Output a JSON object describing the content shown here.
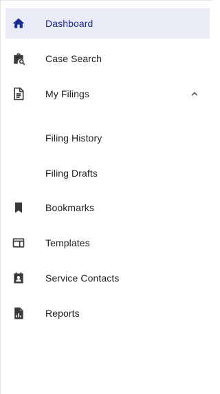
{
  "sidebar": {
    "items": [
      {
        "label": "Dashboard",
        "icon": "home-icon",
        "active": true
      },
      {
        "label": "Case Search",
        "icon": "briefcase-search-icon"
      },
      {
        "label": "My Filings",
        "icon": "document-icon",
        "expanded": true
      },
      {
        "label": "Filing History",
        "sub": true
      },
      {
        "label": "Filing Drafts",
        "sub": true
      },
      {
        "label": "Bookmarks",
        "icon": "bookmark-icon"
      },
      {
        "label": "Templates",
        "icon": "template-icon"
      },
      {
        "label": "Service Contacts",
        "icon": "contact-calendar-icon"
      },
      {
        "label": "Reports",
        "icon": "report-icon"
      }
    ]
  },
  "colors": {
    "accent": "#1a2b8f",
    "active_bg": "#e9ebf7",
    "icon": "#3a3a3a",
    "text": "#1f1f1f"
  }
}
